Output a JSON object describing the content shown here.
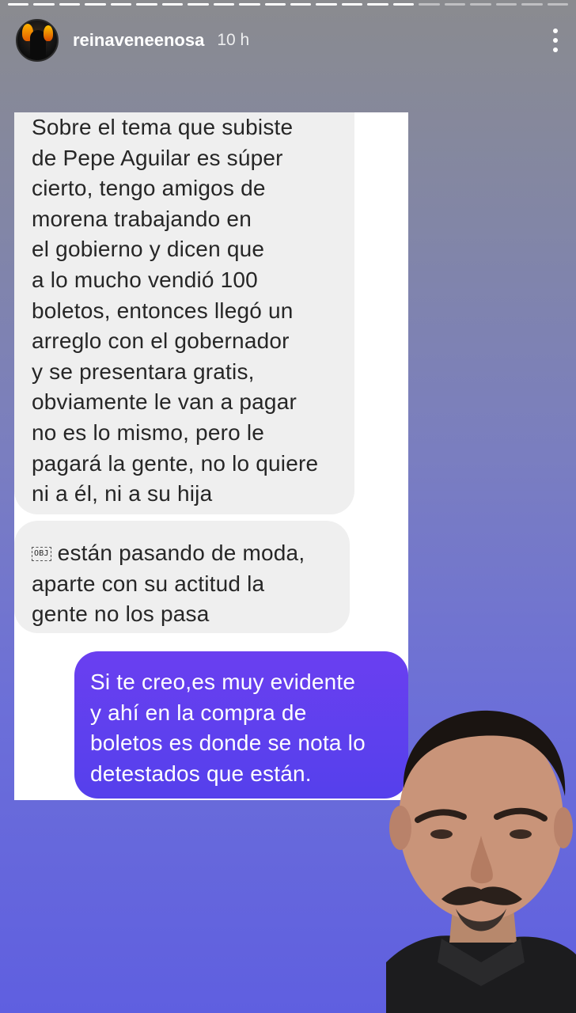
{
  "story": {
    "progress_segments": 22,
    "progress_done": 16,
    "username": "reinaveneenosa",
    "time_ago": "10 h"
  },
  "chat": {
    "messages": [
      {
        "direction": "incoming",
        "lines": [
          "Sobre el tema que subiste",
          "de Pepe Aguilar es súper",
          "cierto, tengo amigos de",
          "morena trabajando en",
          "el gobierno y dicen que",
          "a lo mucho vendió 100",
          "boletos, entonces llegó un",
          "arreglo con el gobernador",
          "y se presentara gratis,",
          "obviamente le van a pagar",
          "no es lo mismo, pero le",
          "pagará la gente, no lo quiere",
          "ni a él, ni a su hija"
        ]
      },
      {
        "direction": "incoming",
        "obj_glyph": "OBJ",
        "lines": [
          "están pasando de moda,",
          "aparte con su actitud la",
          "gente no los pasa"
        ]
      },
      {
        "direction": "outgoing",
        "lines": [
          "Si te creo,es muy evidente",
          "y ahí en la compra de",
          "boletos es donde se nota lo",
          "detestados que están."
        ]
      }
    ]
  },
  "colors": {
    "outgoing_bubble": "#5b3fee",
    "incoming_bubble": "#efefef",
    "background_top": "#8a8b8f",
    "background_bottom": "#5f5fe0"
  },
  "icons": {
    "menu": "more-vertical-icon",
    "avatar": "profile-avatar"
  }
}
